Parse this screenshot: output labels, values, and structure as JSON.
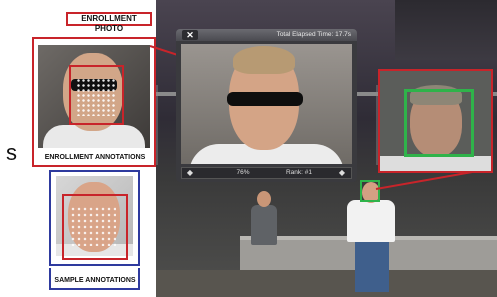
{
  "slide": {
    "fragment_text": "s"
  },
  "enrollment": {
    "photo_label": "ENROLLMENT PHOTO",
    "annotations_label": "ENROLLMENT ANNOTATIONS"
  },
  "sample": {
    "annotations_label": "SAMPLE ANNOTATIONS"
  },
  "match_window": {
    "close_glyph": "✕",
    "title": "Total Elapsed Time: 17.7s",
    "nav_left_glyph": "◆",
    "score": "76%",
    "rank": "Rank: #1",
    "nav_right_glyph": "◆"
  },
  "colors": {
    "enrollment_accent": "#c8242a",
    "sample_accent": "#2e3a9e",
    "match_accent": "#2fb34a"
  },
  "icons": {
    "close": "close-icon",
    "nav_prev": "diamond-left-icon",
    "nav_next": "diamond-right-icon"
  }
}
